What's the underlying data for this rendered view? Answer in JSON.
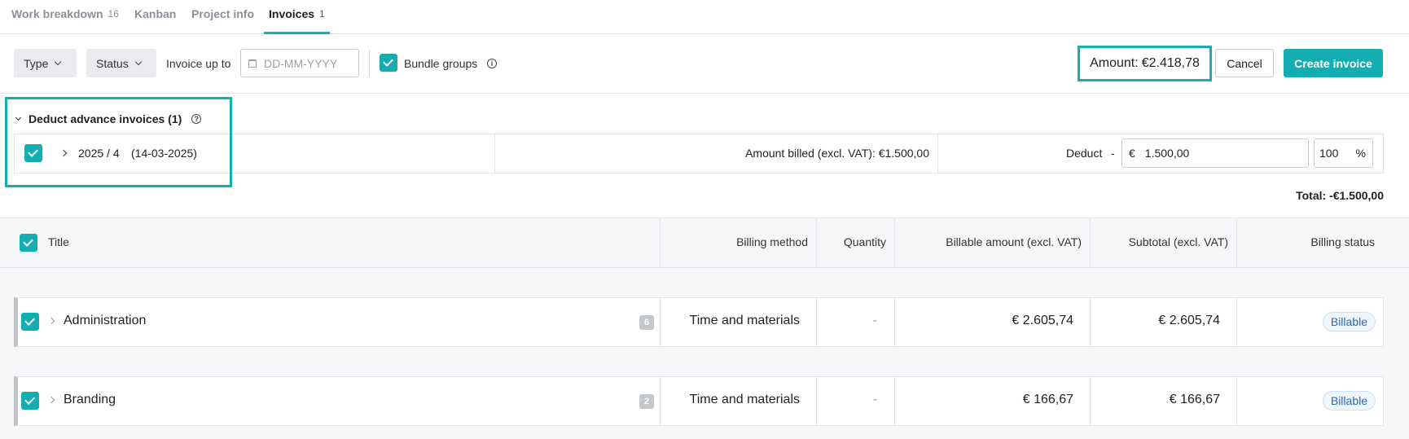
{
  "tabs": [
    {
      "label": "Work breakdown",
      "count": "16"
    },
    {
      "label": "Kanban",
      "count": ""
    },
    {
      "label": "Project info",
      "count": ""
    },
    {
      "label": "Invoices",
      "count": "1"
    }
  ],
  "toolbar": {
    "type_label": "Type",
    "status_label": "Status",
    "invoice_up_to_label": "Invoice up to",
    "date_placeholder": "DD-MM-YYYY",
    "bundle_groups_label": "Bundle groups",
    "amount_label": "Amount:",
    "amount_value": "€2.418,78",
    "cancel_label": "Cancel",
    "create_label": "Create invoice"
  },
  "deduct": {
    "heading": "Deduct advance invoices (1)",
    "invoice_number": "2025 / 4",
    "invoice_date": "(14-03-2025)",
    "amount_billed": "Amount billed (excl. VAT): €1.500,00",
    "deduct_label": "Deduct",
    "deduct_sign": "-",
    "currency": "€",
    "deduct_amount": "1.500,00",
    "percent": "100",
    "percent_sign": "%",
    "total": "Total: -€1.500,00"
  },
  "table": {
    "headers": {
      "title": "Title",
      "billing_method": "Billing method",
      "quantity": "Quantity",
      "billable_amount": "Billable amount (excl. VAT)",
      "subtotal": "Subtotal (excl. VAT)",
      "billing_status": "Billing status"
    },
    "rows": [
      {
        "title": "Administration",
        "count": "6",
        "billing_method": "Time and materials",
        "quantity": "-",
        "billable_amount": "€ 2.605,74",
        "subtotal": "€ 2.605,74",
        "status": "Billable"
      },
      {
        "title": "Branding",
        "count": "2",
        "billing_method": "Time and materials",
        "quantity": "-",
        "billable_amount": "€ 166,67",
        "subtotal": "€ 166,67",
        "status": "Billable"
      }
    ]
  },
  "colors": {
    "accent": "#14aeb2",
    "badge_text": "#2b69b4"
  }
}
